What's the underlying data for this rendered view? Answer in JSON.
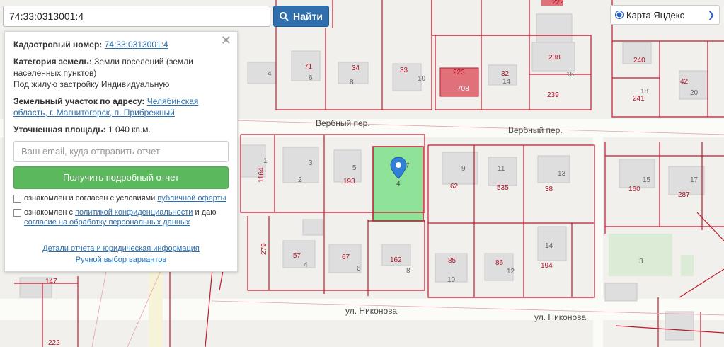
{
  "search": {
    "value": "74:33:0313001:4",
    "button_label": "Найти",
    "button_icon": "search-icon"
  },
  "map_type": {
    "label": "Карта Яндекс",
    "icon": "chevron-down-icon"
  },
  "panel": {
    "cadastral_label": "Кадастровый номер:",
    "cadastral_value": "74:33:0313001:4",
    "category_label": "Категория земель:",
    "category_value": "Земли поселений (земли населенных пунктов)",
    "usage_value": "Под жилую застройку Индивидуальную",
    "address_label": "Земельный участок по адресу:",
    "address_value": "Челябинская область, г. Магнитогорск, п. Прибрежный",
    "area_label": "Уточненная площадь:",
    "area_value": "1 040 кв.м.",
    "email_placeholder": "Ваш email, куда отправить отчет",
    "get_report_label": "Получить подробный отчет",
    "consent1_text": "ознакомлен и согласен с условиями",
    "consent1_link": "публичной оферты",
    "consent2_text": "ознакомлен с",
    "consent2_link": "политикой конфиденциальности",
    "consent2_tail": "и даю",
    "consent2_link2": "согласие на обработку персональных данных",
    "details_link": "Детали отчета и юридическая информация",
    "manual_link": "Ручной выбор вариантов"
  },
  "streets": [
    "Вербный пер.",
    "Вербный пер.",
    "ул. Никонова",
    "ул. Никонова"
  ],
  "marker_label": "4",
  "labels": [
    "222",
    "4",
    "71",
    "6",
    "34",
    "8",
    "33",
    "10",
    "223",
    "708",
    "32",
    "14",
    "238",
    "16",
    "239",
    "240",
    "42",
    "241",
    "18",
    "20",
    "1",
    "1164",
    "3",
    "2",
    "5",
    "193",
    "7",
    "9",
    "62",
    "11",
    "535",
    "13",
    "38",
    "15",
    "160",
    "17",
    "287",
    "279",
    "57",
    "4",
    "67",
    "6",
    "162",
    "8",
    "85",
    "10",
    "86",
    "12",
    "14",
    "194",
    "3",
    "147",
    "222"
  ],
  "colors": {
    "highlight": "#7ee08a",
    "boundary": "#c0182c",
    "building_red": "#e0707a",
    "search_button": "#2f6fad",
    "report_button": "#5cb85c",
    "link": "#2a6fb0"
  }
}
